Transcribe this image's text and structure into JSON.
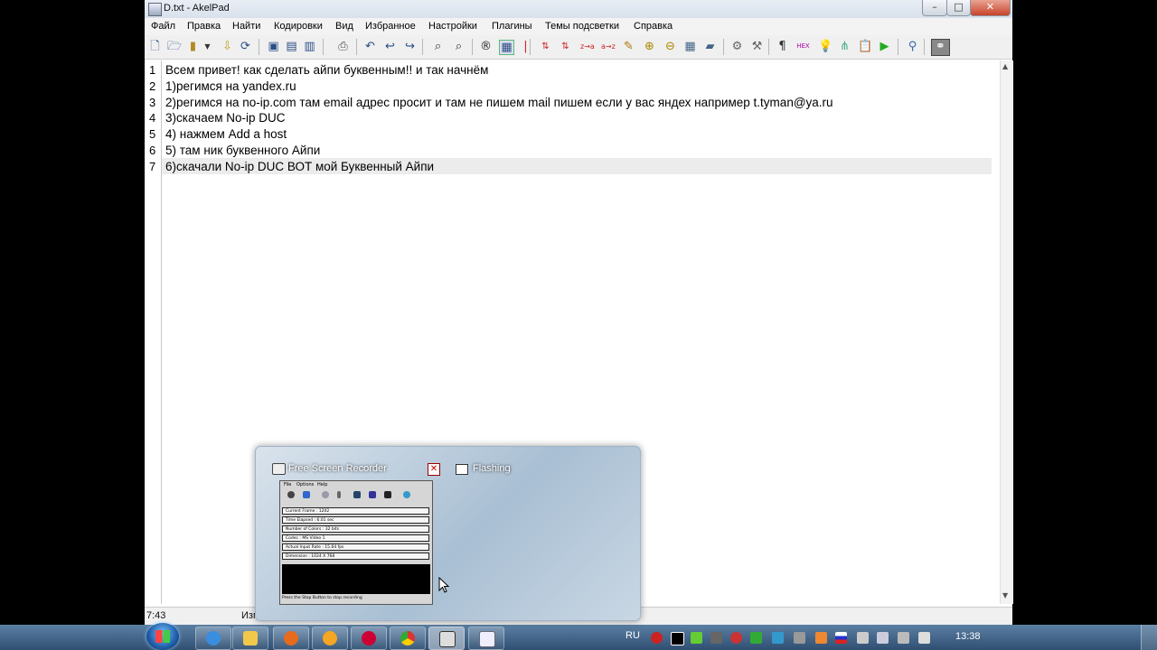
{
  "window": {
    "title": "D.txt - AkelPad",
    "controls": {
      "minimize": "–",
      "maximize": "□",
      "close": "✕"
    }
  },
  "menu": [
    "Файл",
    "Правка",
    "Найти",
    "Кодировки",
    "Вид",
    "Избранное",
    "Настройки",
    "Плагины",
    "Темы подсветки",
    "Справка"
  ],
  "toolbar_icons": [
    "new-icon",
    "open-icon",
    "open-dropdown-icon",
    "recent-icon",
    "reopen-icon",
    "save-icon",
    "save-as-icon",
    "save-all-icon",
    "print-icon",
    "undo-all-icon",
    "undo-icon",
    "redo-icon",
    "find-icon",
    "find-replace-icon",
    "record-icon",
    "macro-icon",
    "sort-icon",
    "case-icon",
    "sort-asc-icon",
    "sort-desc-icon",
    "color-icon",
    "plus-icon",
    "minus-icon",
    "grid-icon",
    "format-icon",
    "settings-icon",
    "tools-icon",
    "pilcrow-icon",
    "hex-icon",
    "bulb-icon",
    "tree-icon",
    "clipboard-icon",
    "run-icon",
    "plugin-icon",
    "binoculars-icon"
  ],
  "editor": {
    "lines": [
      {
        "n": "1",
        "text": "Всем привет! как сделать айпи буквенным!! и так начнём"
      },
      {
        "n": "2",
        "text": "1)регимся на yandex.ru"
      },
      {
        "n": "3",
        "text": "2)регимся на no-ip.com там email адрес просит и там не пишем mail пишем если у вас яндех например t.tyman@ya.ru"
      },
      {
        "n": "4",
        "text": "3)скачаем No-ip DUC"
      },
      {
        "n": "5",
        "text": "4) нажмем Add a host"
      },
      {
        "n": "6",
        "text": "5) там ник буквенного Айпи"
      },
      {
        "n": "7",
        "text": "6)скачали No-ip DUC ВОТ мой Буквенный Айпи"
      }
    ]
  },
  "status": {
    "position": "7:43",
    "modified": "Изменён"
  },
  "thumbnail": {
    "title": "Free Screen Recorder",
    "second_title": "Flashing",
    "close": "✕",
    "mini_menu": [
      "File",
      "Options",
      "Help"
    ],
    "mini_rows": [
      "Current Frame : 1202",
      "Time Elapsed : 6.01 sec",
      "Number of Colors : 32 bits",
      "Codec : MS Video 1",
      "Actual Input Rate : 15.64 fps",
      "Dimension : 1024 X 768"
    ],
    "mini_footer": "Press the Stop Button to stop recording"
  },
  "taskbar": {
    "language": "RU",
    "clock": "13:38"
  }
}
